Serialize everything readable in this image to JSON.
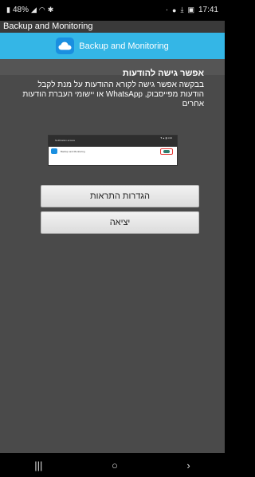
{
  "status_bar": {
    "battery_icon": "battery-icon",
    "battery": "48%",
    "signal_icon": "signal-icon",
    "wifi_icon": "wifi-icon",
    "bluetooth_icon": "bluetooth-icon",
    "dot": "·",
    "shield_icon": "shield-icon",
    "download_icon": "download-icon",
    "image_icon": "image-icon",
    "time": "17:41"
  },
  "window": {
    "title": "Backup and Monitoring"
  },
  "header": {
    "title": "Backup and Monitoring",
    "icon": "cloud-icon",
    "color": "#34b6e6"
  },
  "dialog": {
    "heading": "אפשר גישה להודעות",
    "description": "בבקשה אפשר גישה לקורא ההודעות על מנת לקבל הודעות מפייסבוק, WhatsApp או יישומי העברת הודעות אחרים",
    "example": {
      "menu_text": "Notification access",
      "status_text": "▼▲ ▮ 4:00",
      "row_label": "Backup and Monitoring"
    }
  },
  "buttons": {
    "settings": "הגדרות התראות",
    "exit": "יציאה"
  },
  "nav": {
    "recent": "|||",
    "home": "○",
    "back": "›"
  }
}
